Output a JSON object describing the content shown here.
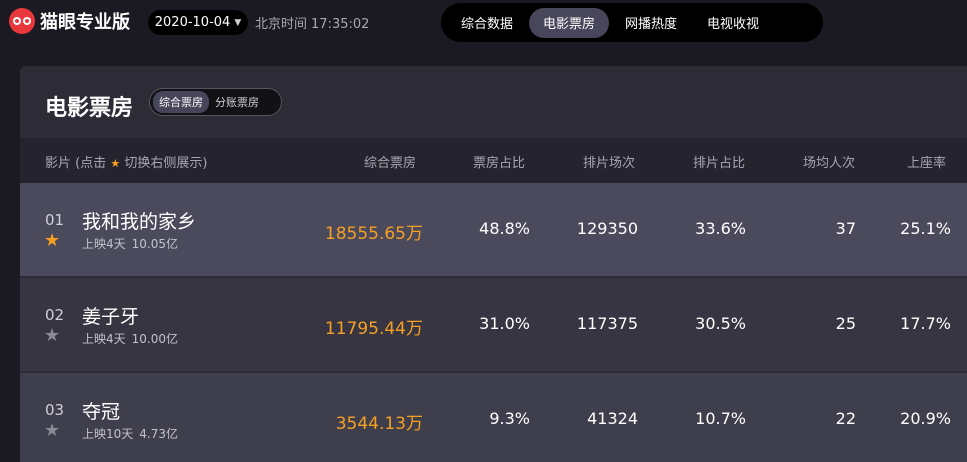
{
  "brand": {
    "name": "猫眼专业版",
    "accent": "#e8373d"
  },
  "date_picker": {
    "value": "2020-10-04"
  },
  "clock": {
    "label": "北京时间",
    "time": "17:35:02"
  },
  "top_nav": [
    {
      "label": "综合数据",
      "active": false
    },
    {
      "label": "电影票房",
      "active": true
    },
    {
      "label": "网播热度",
      "active": false
    },
    {
      "label": "电视收视",
      "active": false
    }
  ],
  "panel": {
    "title": "电影票房",
    "switch": [
      {
        "label": "综合票房",
        "active": true
      },
      {
        "label": "分账票房",
        "active": false
      }
    ]
  },
  "table": {
    "headers": {
      "film_prefix": "影片 (点击",
      "film_suffix": "切换右侧展示)",
      "box": "综合票房",
      "box_share": "票房占比",
      "shows": "排片场次",
      "show_share": "排片占比",
      "avg_people": "场均人次",
      "occupancy": "上座率"
    },
    "rows": [
      {
        "rank": "01",
        "name": "我和我的家乡",
        "days": "上映4天",
        "total": "10.05亿",
        "box": "18555.65万",
        "box_share": "48.8%",
        "shows": "129350",
        "show_share": "33.6%",
        "avg_people": "37",
        "occupancy": "25.1%",
        "starred": true
      },
      {
        "rank": "02",
        "name": "姜子牙",
        "days": "上映4天",
        "total": "10.00亿",
        "box": "11795.44万",
        "box_share": "31.0%",
        "shows": "117375",
        "show_share": "30.5%",
        "avg_people": "25",
        "occupancy": "17.7%",
        "starred": false
      },
      {
        "rank": "03",
        "name": "夺冠",
        "days": "上映10天",
        "total": "4.73亿",
        "box": "3544.13万",
        "box_share": "9.3%",
        "shows": "41324",
        "show_share": "10.7%",
        "avg_people": "22",
        "occupancy": "20.9%",
        "starred": false
      }
    ]
  },
  "colors": {
    "highlight": "#f6a023",
    "background": "#1b1a22",
    "panel": "#2c2b36"
  },
  "icons": {
    "favorite": "star-icon",
    "dropdown": "chevron-down-icon",
    "logo": "cat-eye-logo-icon"
  }
}
